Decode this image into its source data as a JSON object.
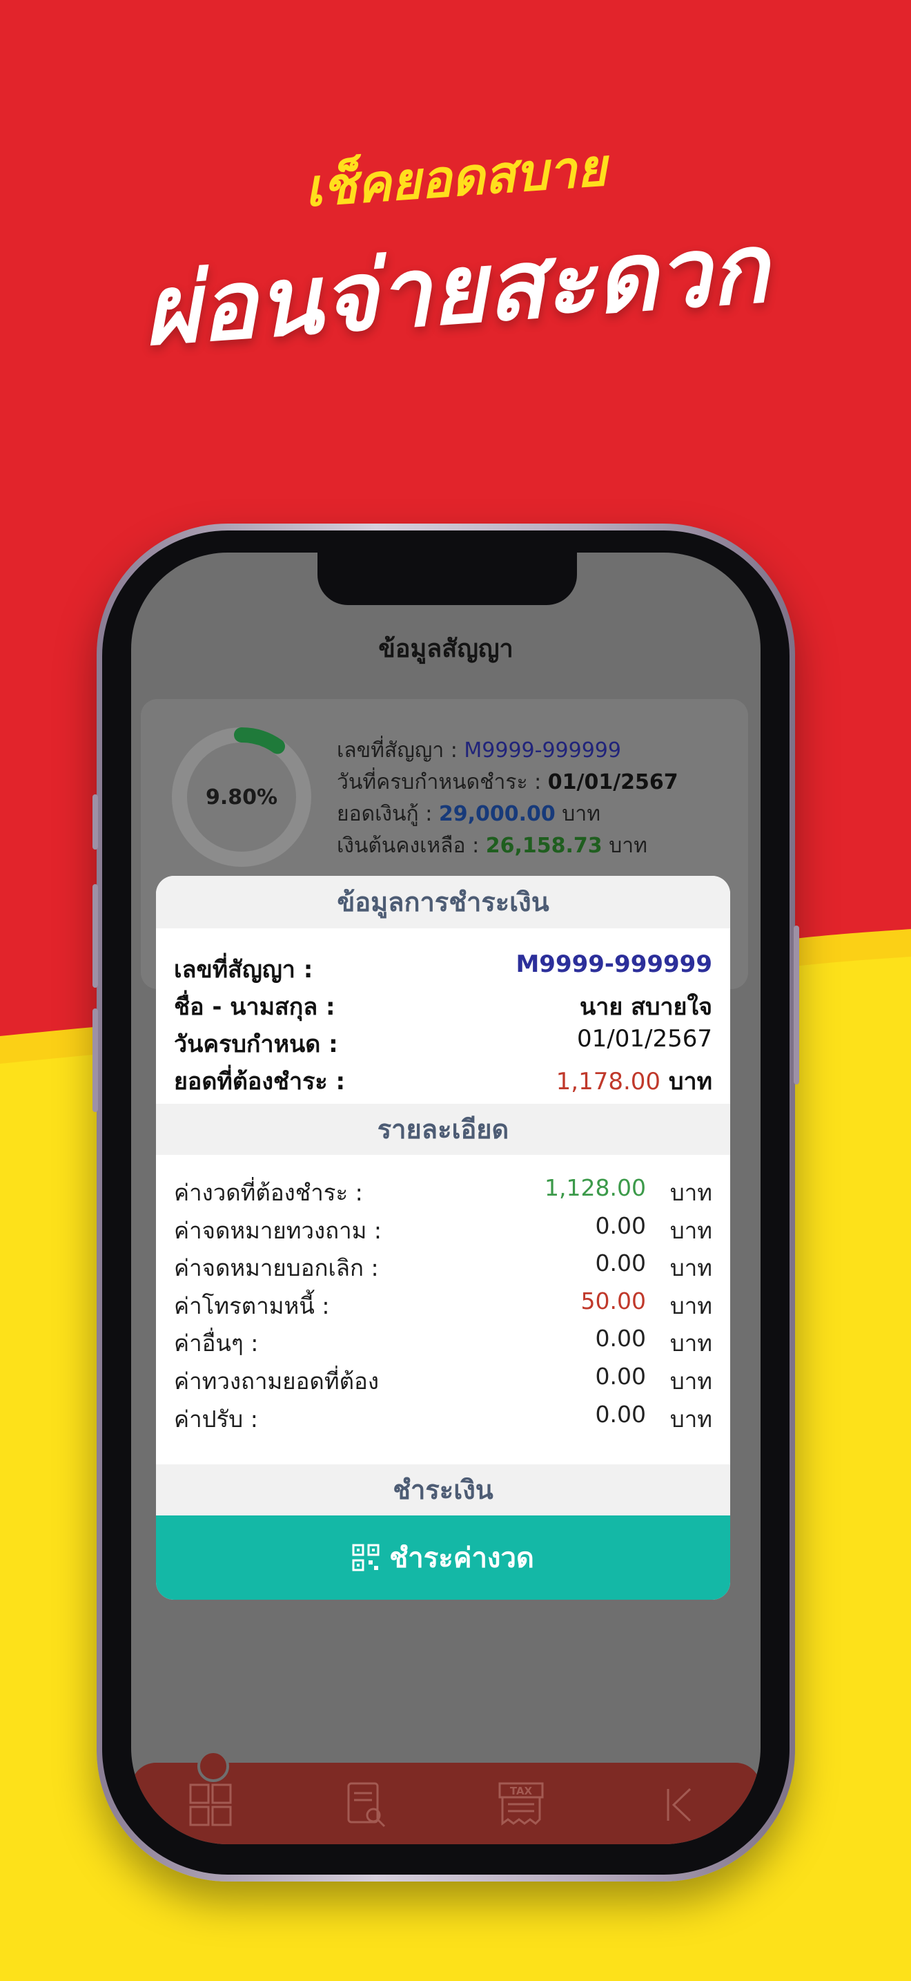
{
  "headline": {
    "top": "เช็คยอดสบาย",
    "main": "ผ่อนจ่ายสะดวก"
  },
  "colors": {
    "red_bg": "#e2242b",
    "yellow_bg": "#fde11a",
    "accent_teal": "#14b8a6",
    "amount_red": "#c0392b",
    "amount_green": "#3c9a4a",
    "contract_blue": "#2c2f9a"
  },
  "screen": {
    "title": "ข้อมูลสัญญา",
    "card": {
      "progress_percent": 9.8,
      "progress_label": "9.80%",
      "contract_no_label": "เลขที่สัญญา : ",
      "contract_no": "M9999-999999",
      "due_date_label": "วันที่ครบกำหนดชำระ : ",
      "due_date": "01/01/2567",
      "loan_amount_label": "ยอดเงินกู้ : ",
      "loan_amount": "29,000.00",
      "loan_amount_unit": " บาท",
      "principal_left_label": "เงินต้นคงเหลือ : ",
      "principal_left": "26,158.73",
      "principal_left_unit": " บาท"
    }
  },
  "modal": {
    "title": "ข้อมูลการชำระเงิน",
    "info": [
      {
        "label": "เลขที่สัญญา :",
        "value": "M9999-999999"
      },
      {
        "label": "ชื่อ - นามสกุล :",
        "value": "นาย สบายใจ"
      },
      {
        "label": "วันครบกำหนด :",
        "value": "01/01/2567"
      },
      {
        "label": "ยอดที่ต้องชำระ :",
        "value": "1,178.00",
        "unit": "บาท"
      }
    ],
    "details_title": "รายละเอียด",
    "details": [
      {
        "label": "ค่างวดที่ต้องชำระ :",
        "amount": "1,128.00",
        "unit": "บาท"
      },
      {
        "label": "ค่าจดหมายทวงถาม :",
        "amount": "0.00",
        "unit": "บาท"
      },
      {
        "label": "ค่าจดหมายบอกเลิก :",
        "amount": "0.00",
        "unit": "บาท"
      },
      {
        "label": "ค่าโทรตามหนี้ :",
        "amount": "50.00",
        "unit": "บาท"
      },
      {
        "label": "ค่าอื่นๆ :",
        "amount": "0.00",
        "unit": "บาท"
      },
      {
        "label": "ค่าทวงถามยอดที่ต้อง",
        "amount": "0.00",
        "unit": "บาท"
      },
      {
        "label": "ค่าปรับ :",
        "amount": "0.00",
        "unit": "บาท"
      }
    ],
    "pay_title": "ชำระเงิน",
    "pay_button": "ชำระค่างวด"
  },
  "bottom_nav": {
    "icons": [
      "grid-icon",
      "document-search-icon",
      "tax-invoice-icon",
      "back-icon"
    ]
  }
}
